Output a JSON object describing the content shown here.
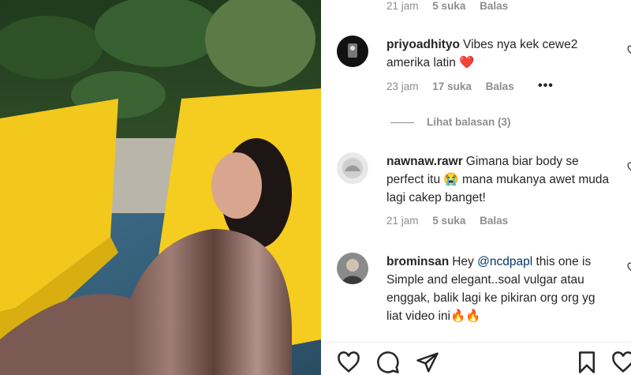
{
  "top_comment_meta": {
    "time": "21 jam",
    "likes": "5 suka",
    "reply": "Balas"
  },
  "comments": [
    {
      "username": "priyoadhityo",
      "text": "Vibes nya kek cewe2 amerika latin",
      "emoji": "❤️",
      "time": "23 jam",
      "likes": "17 suka",
      "reply": "Balas",
      "more": "•••"
    },
    {
      "username": "nawnaw.rawr",
      "text_before": "Gimana biar body se perfect itu ",
      "emoji": "😭",
      "text_after": " mana mukanya awet muda lagi cakep banget!",
      "time": "21 jam",
      "likes": "5 suka",
      "reply": "Balas"
    },
    {
      "username": "brominsan",
      "text_before": "Hey ",
      "mention": "@ncdpapl",
      "text_after": " this one is Simple and elegant..soal vulgar atau enggak, balik lagi ke pikiran org org yg liat video ini",
      "emoji": "🔥🔥"
    }
  ],
  "view_replies": "Lihat balasan (3)",
  "icons": {
    "like": "heart-icon",
    "comment": "comment-icon",
    "share": "send-icon",
    "save": "bookmark-icon",
    "comment_like": "heart-outline-icon"
  },
  "colors": {
    "text": "#262626",
    "muted": "#8e8e8e",
    "mention": "#00376b",
    "red_heart": "#ed4956"
  }
}
